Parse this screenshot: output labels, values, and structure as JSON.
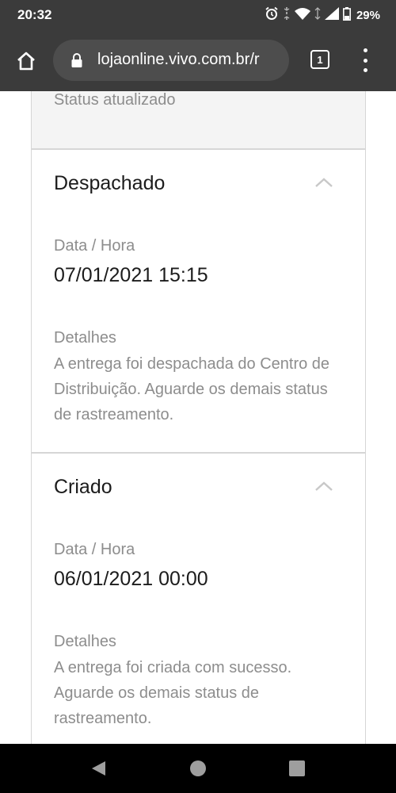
{
  "status_bar": {
    "time": "20:32",
    "battery_percent": "29%",
    "icons": [
      "alarm-icon",
      "vibrate-icon",
      "wifi-icon",
      "signal-icon",
      "battery-icon"
    ]
  },
  "browser": {
    "url": "lojaonline.vivo.com.br/r",
    "tab_count": "1",
    "icons": [
      "home-icon",
      "lock-icon",
      "tabs-icon",
      "more-vert-icon"
    ]
  },
  "tracking": {
    "previous_status_text": "Status atualizado",
    "events": [
      {
        "title": "Despachado",
        "datetime_label": "Data / Hora",
        "datetime_value": "07/01/2021 15:15",
        "details_label": "Detalhes",
        "details_text": "A entrega foi despachada do Centro de Distribuição. Aguarde os demais status de rastreamento."
      },
      {
        "title": "Criado",
        "datetime_label": "Data / Hora",
        "datetime_value": "06/01/2021 00:00",
        "details_label": "Detalhes",
        "details_text": "A entrega foi criada com sucesso. Aguarde os demais status de rastreamento."
      }
    ]
  },
  "colors": {
    "chrome_bar": "#3b3b3b",
    "omnibox": "#4d4d4d",
    "card_border": "#d6d6d6",
    "muted_text": "#8d8d8d",
    "primary_text": "#1c1c1c"
  }
}
